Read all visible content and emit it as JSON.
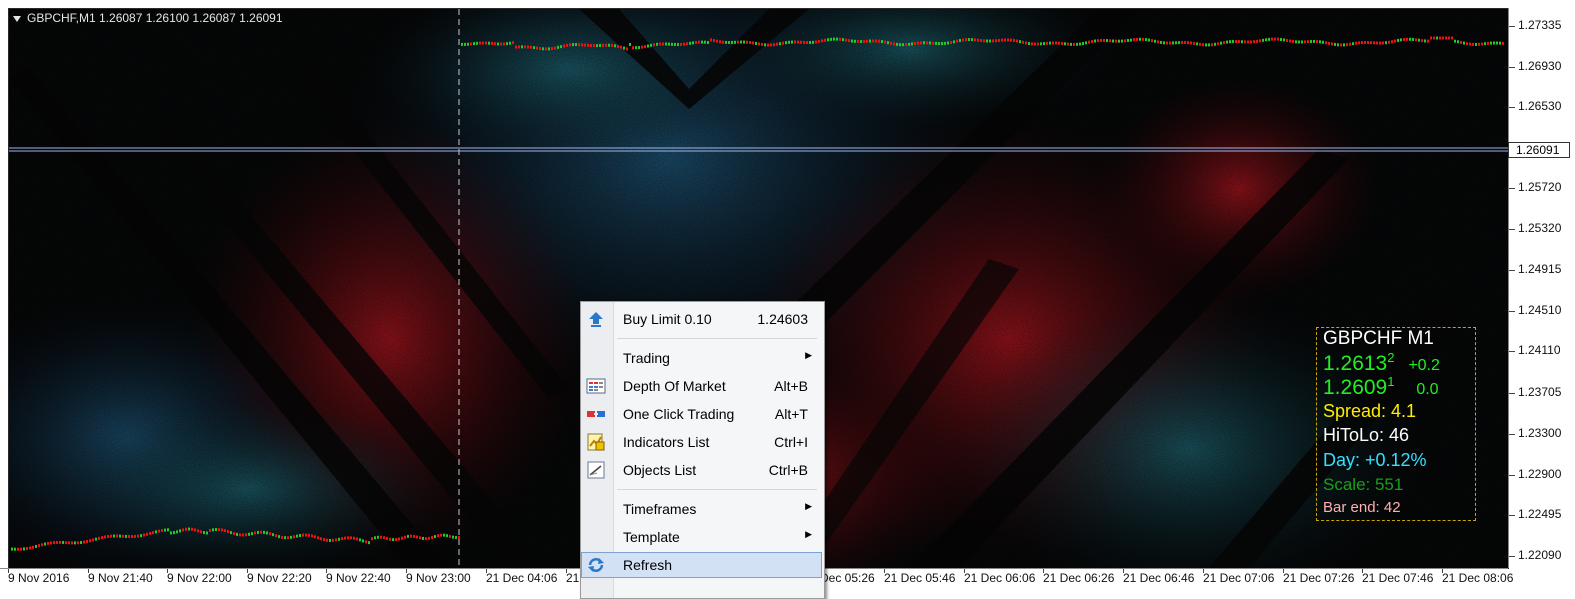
{
  "chart": {
    "header": "GBPCHF,M1  1.26087 1.26100 1.26087 1.26091",
    "current_price": "1.26091",
    "price_labels": [
      "1.27335",
      "1.26930",
      "1.26530",
      "1.25720",
      "1.25320",
      "1.24915",
      "1.24510",
      "1.24110",
      "1.23705",
      "1.23300",
      "1.22900",
      "1.22495",
      "1.22090"
    ],
    "time_labels": [
      "9 Nov 2016",
      "9 Nov 21:40",
      "9 Nov 22:00",
      "9 Nov 22:20",
      "9 Nov 22:40",
      "9 Nov 23:00",
      "21 Dec 04:06",
      "21",
      "Dec 05:26",
      "21 Dec 05:46",
      "21 Dec 06:06",
      "21 Dec 06:26",
      "21 Dec 06:46",
      "21 Dec 07:06",
      "21 Dec 07:26",
      "21 Dec 07:46",
      "21 Dec 08:06"
    ],
    "colors": {
      "bull": "#22cc22",
      "bear": "#ee1111",
      "price_line": "#9fb6e8",
      "separator": "#c8c8c8"
    }
  },
  "context_menu": {
    "items": [
      {
        "label": "Buy Limit 0.10",
        "shortcut": "1.24603",
        "icon": "buy-limit-icon"
      },
      {
        "label": "Trading",
        "submenu": true
      },
      {
        "label": "Depth Of Market",
        "shortcut": "Alt+B",
        "icon": "depth-of-market-icon"
      },
      {
        "label": "One Click Trading",
        "shortcut": "Alt+T",
        "icon": "one-click-trading-icon"
      },
      {
        "label": "Indicators List",
        "shortcut": "Ctrl+I",
        "icon": "indicators-list-icon"
      },
      {
        "label": "Objects List",
        "shortcut": "Ctrl+B",
        "icon": "objects-list-icon"
      },
      {
        "label": "Timeframes",
        "submenu": true
      },
      {
        "label": "Template",
        "submenu": true
      },
      {
        "label": "Refresh",
        "icon": "refresh-icon",
        "highlighted": true
      }
    ],
    "submenu_arrow": "▶"
  },
  "info_panel": {
    "symbol": "GBPCHF M1",
    "ask": {
      "price": "1.2613",
      "pip": "2",
      "change": "+0.2"
    },
    "bid": {
      "price": "1.2609",
      "pip": "1",
      "change": "0.0"
    },
    "spread": "Spread: 4.1",
    "hitolo": "HiToLo: 46",
    "day": "Day: +0.12%",
    "scale": "Scale: 551",
    "bar_end": "Bar end: 42",
    "colors": {
      "symbol": "#ffffff",
      "price": "#22ee22",
      "spread": "#ffee00",
      "hitolo": "#ffffff",
      "day": "#33e0ff",
      "scale": "#18a018",
      "bar_end": "#ffb0b0",
      "border": "#c9a400"
    }
  }
}
